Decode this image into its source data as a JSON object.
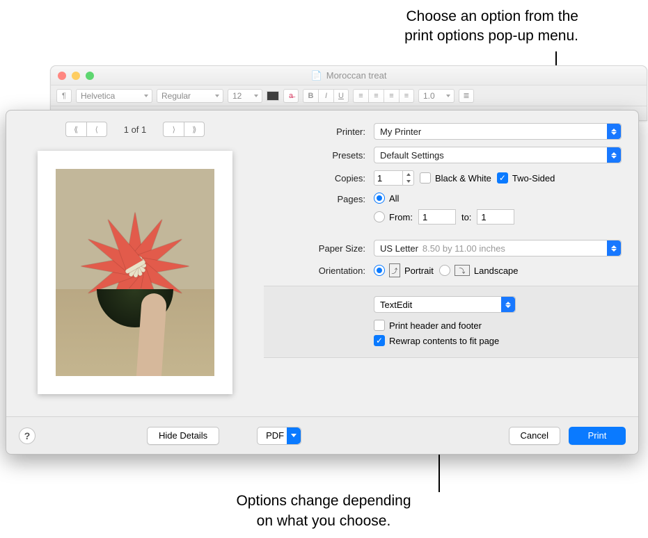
{
  "annotations": {
    "top": "Choose an option from the\nprint options pop-up menu.",
    "bottom": "Options change depending\non what you choose."
  },
  "window": {
    "title": "Moroccan treat",
    "font_family": "Helvetica",
    "font_style": "Regular",
    "font_size": "12",
    "line_spacing": "1.0"
  },
  "dialog": {
    "nav": {
      "page_indicator": "1 of 1"
    },
    "printer": {
      "label": "Printer:",
      "value": "My Printer"
    },
    "presets": {
      "label": "Presets:",
      "value": "Default Settings"
    },
    "copies": {
      "label": "Copies:",
      "value": "1",
      "bw_label": "Black & White",
      "bw_checked": false,
      "twosided_label": "Two-Sided",
      "twosided_checked": true
    },
    "pages": {
      "label": "Pages:",
      "all_label": "All",
      "all_selected": true,
      "from_label": "From:",
      "from_value": "1",
      "to_label": "to:",
      "to_value": "1"
    },
    "paper": {
      "label": "Paper Size:",
      "value": "US Letter",
      "dimensions": "8.50 by 11.00 inches"
    },
    "orientation": {
      "label": "Orientation:",
      "portrait_label": "Portrait",
      "portrait_selected": true,
      "landscape_label": "Landscape",
      "landscape_selected": false
    },
    "app_options": {
      "menu_value": "TextEdit",
      "header_footer_label": "Print header and footer",
      "header_footer_checked": false,
      "rewrap_label": "Rewrap contents to fit page",
      "rewrap_checked": true
    },
    "footer": {
      "help": "?",
      "hide_details": "Hide Details",
      "pdf": "PDF",
      "cancel": "Cancel",
      "print": "Print"
    }
  }
}
